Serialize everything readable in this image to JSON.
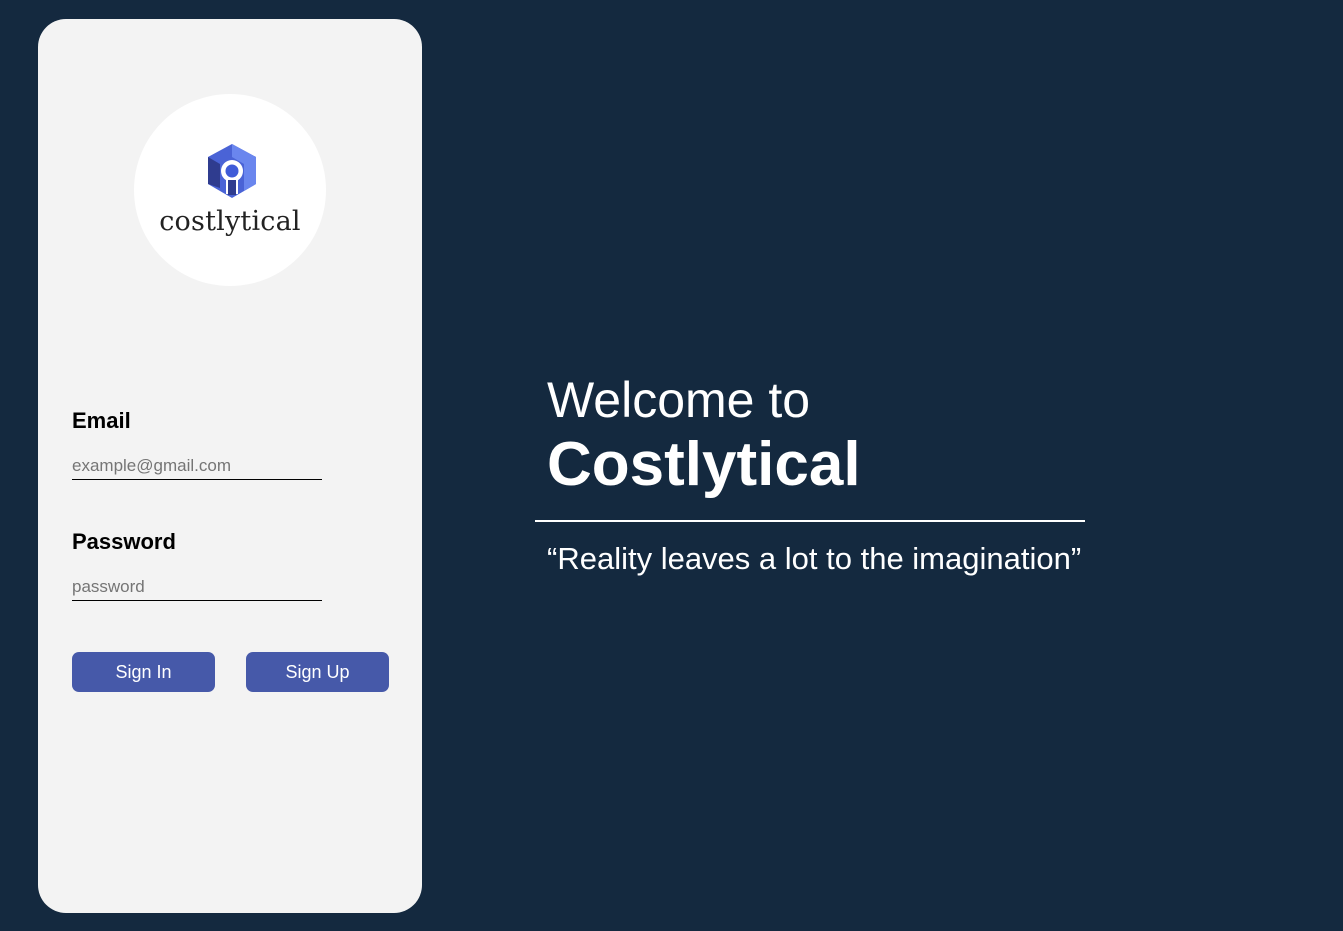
{
  "brand": {
    "logo_text": "costlytical",
    "logo_icon": "shield-logo-icon"
  },
  "login": {
    "email_label": "Email",
    "email_placeholder": "example@gmail.com",
    "email_value": "",
    "password_label": "Password",
    "password_placeholder": "password",
    "password_value": "",
    "sign_in_label": "Sign In",
    "sign_up_label": "Sign Up"
  },
  "hero": {
    "welcome": "Welcome to",
    "title": "Costlytical",
    "quote": "“Reality leaves a lot to the imagination”"
  },
  "colors": {
    "background": "#14293f",
    "card": "#f3f3f3",
    "button": "#4659a9",
    "logo_primary": "#3f5bd8",
    "logo_dark": "#2f3c8f"
  }
}
